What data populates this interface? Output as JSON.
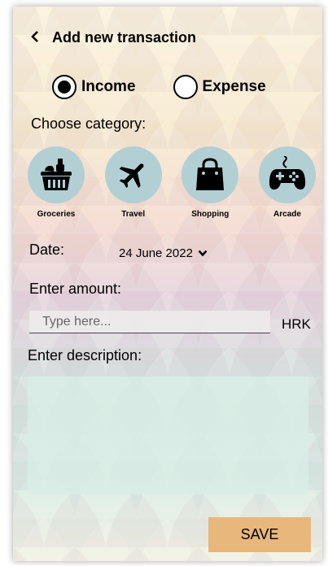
{
  "header": {
    "back_icon": "chevron-left-icon",
    "title": "Add new transaction"
  },
  "type_selector": {
    "income_label": "Income",
    "expense_label": "Expense",
    "selected": "Income"
  },
  "category": {
    "heading": "Choose category:",
    "items": [
      {
        "label": "Groceries",
        "icon": "basket-icon"
      },
      {
        "label": "Travel",
        "icon": "airplane-icon"
      },
      {
        "label": "Shopping",
        "icon": "shopping-bag-icon"
      },
      {
        "label": "Arcade",
        "icon": "gamepad-icon"
      }
    ],
    "circle_color": "#b2cfd4"
  },
  "date": {
    "label": "Date:",
    "value": "24 June 2022",
    "dropdown_icon": "chevron-down-icon"
  },
  "amount": {
    "label": "Enter amount:",
    "placeholder": "Type here...",
    "currency": "HRK"
  },
  "description": {
    "label": "Enter description:",
    "value": ""
  },
  "save_button": {
    "label": "SAVE",
    "color": "#e8b77c"
  }
}
